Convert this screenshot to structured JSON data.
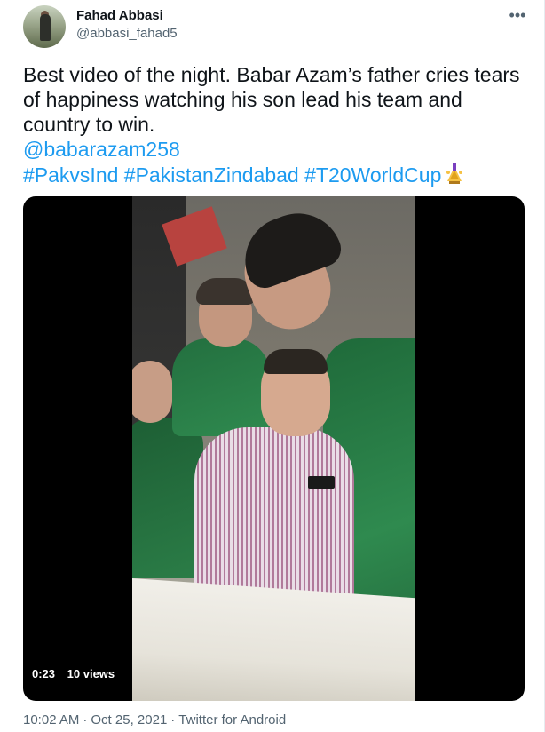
{
  "author": {
    "display_name": "Fahad Abbasi",
    "handle": "@abbasi_fahad5"
  },
  "more_icon": "more-dots-icon",
  "tweet": {
    "lines": [
      "Best video of the night. Babar Azam’s father cries tears",
      "of happiness watching his son lead his team and",
      "country to win."
    ],
    "mention": "@babarazam258",
    "hashtags": [
      "#PakvsInd",
      "#PakistanZindabad",
      "#T20WorldCup"
    ],
    "emoji_icon": "trophy-icon"
  },
  "video": {
    "time": "0:23",
    "views": "10 views"
  },
  "meta": {
    "time": "10:02 AM",
    "date": "Oct 25, 2021",
    "source": "Twitter for Android",
    "separator": "·"
  },
  "colors": {
    "link": "#1d9bf0",
    "secondary_text": "#536471",
    "primary_text": "#0f1419"
  }
}
